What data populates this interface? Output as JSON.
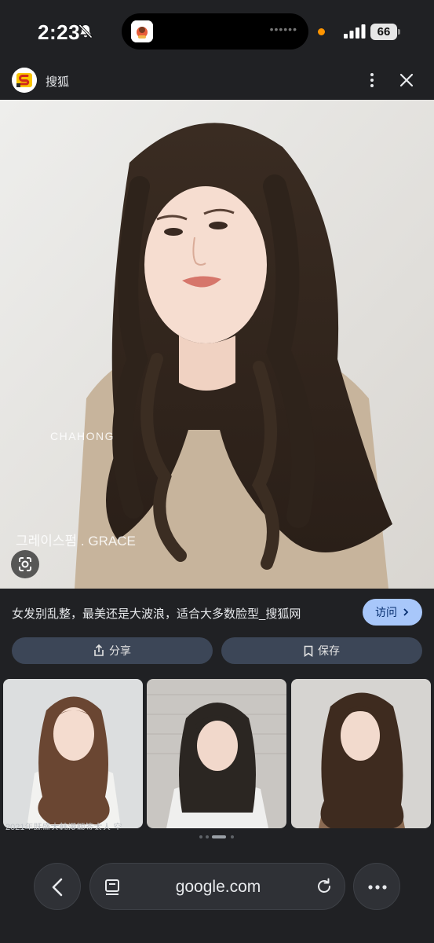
{
  "status_bar": {
    "time": "2:23",
    "battery": "66"
  },
  "header": {
    "site_name": "搜狐"
  },
  "main_image": {
    "watermark_1": "CHAHONG",
    "watermark_2": "그레이스펌 . GRACE"
  },
  "result": {
    "title": "女发别乱整，最美还是大波浪，适合大多数脸型_搜狐网",
    "visit_label": "访问",
    "share_label": "分享",
    "save_label": "保存"
  },
  "related": [
    {
      "caption": "2021年既盛大韩漫额签太人 空"
    }
  ],
  "browser": {
    "url": "google.com"
  },
  "colors": {
    "background": "#202124",
    "visit_button": "#a8c7fa",
    "action_button": "#3c4657"
  }
}
